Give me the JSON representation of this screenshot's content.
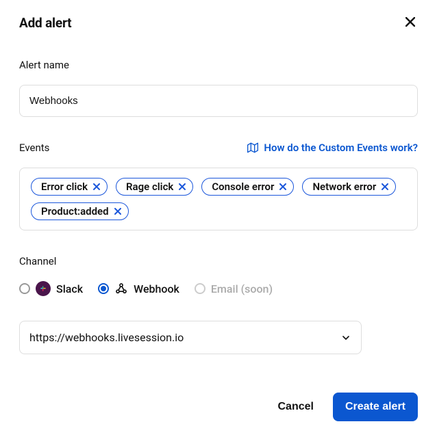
{
  "dialog": {
    "title": "Add alert"
  },
  "alertName": {
    "label": "Alert name",
    "value": "Webhooks"
  },
  "events": {
    "label": "Events",
    "helpText": "How do the Custom Events work?",
    "tags": [
      "Error click",
      "Rage click",
      "Console error",
      "Network error",
      "Product:added"
    ]
  },
  "channel": {
    "label": "Channel",
    "options": {
      "slack": {
        "label": "Slack",
        "selected": false,
        "disabled": false
      },
      "webhook": {
        "label": "Webhook",
        "selected": true,
        "disabled": false
      },
      "email": {
        "label": "Email (soon)",
        "selected": false,
        "disabled": true
      }
    },
    "selectedUrl": "https://webhooks.livesession.io"
  },
  "actions": {
    "cancel": "Cancel",
    "create": "Create alert"
  }
}
